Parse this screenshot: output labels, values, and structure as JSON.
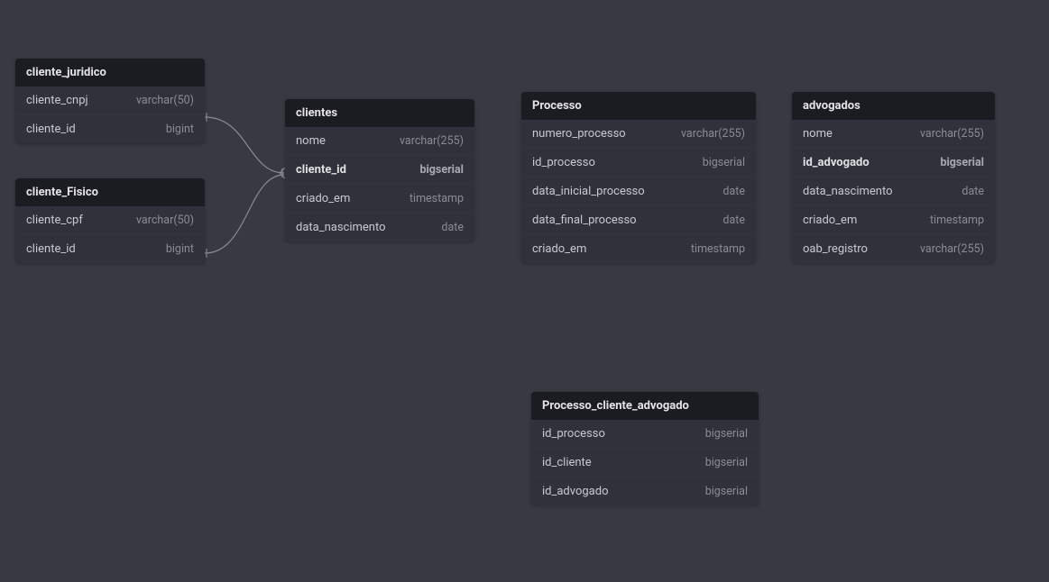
{
  "tables": {
    "cliente_juridico": {
      "title": "cliente_juridico",
      "fields": [
        {
          "name": "cliente_cnpj",
          "type": "varchar(50)",
          "bold": false
        },
        {
          "name": "cliente_id",
          "type": "bigint",
          "bold": false
        }
      ]
    },
    "cliente_fisico": {
      "title": "cliente_Fisico",
      "fields": [
        {
          "name": "cliente_cpf",
          "type": "varchar(50)",
          "bold": false
        },
        {
          "name": "cliente_id",
          "type": "bigint",
          "bold": false
        }
      ]
    },
    "clientes": {
      "title": "clientes",
      "fields": [
        {
          "name": "nome",
          "type": "varchar(255)",
          "bold": false
        },
        {
          "name": "cliente_id",
          "type": "bigserial",
          "bold": true
        },
        {
          "name": "criado_em",
          "type": "timestamp",
          "bold": false
        },
        {
          "name": "data_nascimento",
          "type": "date",
          "bold": false
        }
      ]
    },
    "processo": {
      "title": "Processo",
      "fields": [
        {
          "name": "numero_processo",
          "type": "varchar(255)",
          "bold": false
        },
        {
          "name": "id_processo",
          "type": "bigserial",
          "bold": false
        },
        {
          "name": "data_inicial_processo",
          "type": "date",
          "bold": false
        },
        {
          "name": "data_final_processo",
          "type": "date",
          "bold": false
        },
        {
          "name": "criado_em",
          "type": "timestamp",
          "bold": false
        }
      ]
    },
    "advogados": {
      "title": "advogados",
      "fields": [
        {
          "name": "nome",
          "type": "varchar(255)",
          "bold": false
        },
        {
          "name": "id_advogado",
          "type": "bigserial",
          "bold": true
        },
        {
          "name": "data_nascimento",
          "type": "date",
          "bold": false
        },
        {
          "name": "criado_em",
          "type": "timestamp",
          "bold": false
        },
        {
          "name": "oab_registro",
          "type": "varchar(255)",
          "bold": false
        }
      ]
    },
    "processo_cliente_advogado": {
      "title": "Processo_cliente_advogado",
      "fields": [
        {
          "name": "id_processo",
          "type": "bigserial",
          "bold": false
        },
        {
          "name": "id_cliente",
          "type": "bigserial",
          "bold": false
        },
        {
          "name": "id_advogado",
          "type": "bigserial",
          "bold": false
        }
      ]
    }
  }
}
